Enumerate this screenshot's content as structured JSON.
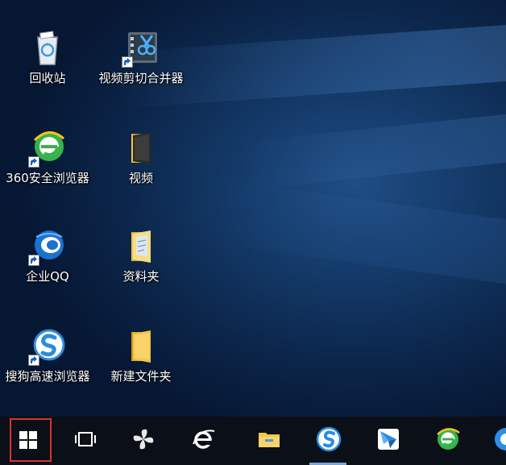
{
  "desktop": {
    "icons": [
      {
        "label": "回收站",
        "icon": "recycle-bin-icon"
      },
      {
        "label": "视频剪切合并器",
        "icon": "video-editor-icon",
        "shortcut": true
      },
      {
        "label": "360安全浏览器",
        "icon": "360-browser-icon",
        "shortcut": true
      },
      {
        "label": "视频",
        "icon": "folder-icon"
      },
      {
        "label": "企业QQ",
        "icon": "enterprise-qq-icon",
        "shortcut": true
      },
      {
        "label": "资料夹",
        "icon": "folder-icon"
      },
      {
        "label": "搜狗高速浏览器",
        "icon": "sogou-browser-icon",
        "shortcut": true
      },
      {
        "label": "新建文件夹",
        "icon": "folder-icon"
      }
    ]
  },
  "taskbar": {
    "items": [
      {
        "icon": "windows-start-icon",
        "highlighted": true
      },
      {
        "icon": "task-view-icon"
      },
      {
        "icon": "pinwheel-app-icon"
      },
      {
        "icon": "internet-explorer-icon"
      },
      {
        "icon": "file-explorer-icon"
      },
      {
        "icon": "sogou-browser-icon",
        "active": true
      },
      {
        "icon": "feishu-app-icon"
      },
      {
        "icon": "360-browser-icon"
      },
      {
        "icon": "partial-app-icon"
      }
    ]
  },
  "colors": {
    "desktop_bg": "#0b2549",
    "taskbar_bg": "#0a0f18",
    "start_highlight": "#e03030",
    "folder_yellow": "#f3c54a"
  }
}
